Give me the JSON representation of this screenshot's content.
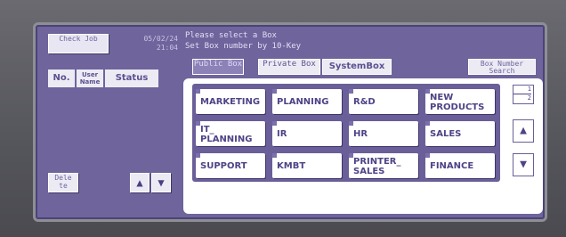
{
  "header": {
    "check_job": "Check Job",
    "date": "05/02/24",
    "time": "21:04"
  },
  "list_headers": {
    "no": "No.",
    "user_name": "User Name",
    "status": "Status"
  },
  "left_buttons": {
    "delete": "Dele te",
    "up_icon": "up-arrow-icon",
    "down_icon": "down-arrow-icon"
  },
  "message": {
    "line1": "Please select a Box",
    "line2": "Set Box number by 10-Key"
  },
  "tabs": {
    "public": "Public Box",
    "private": "Private Box",
    "system": "SystemBox"
  },
  "search": {
    "label": "Box Number Search"
  },
  "boxes": [
    "MARKETING",
    "PLANNING",
    "R&D",
    "NEW PRODUCTS",
    "IT_ PLANNING",
    "IR",
    "HR",
    "SALES",
    "SUPPORT",
    "KMBT",
    "PRINTER_ SALES",
    "FINANCE"
  ],
  "pagination": {
    "current": "1",
    "total": "2"
  },
  "colors": {
    "screen": "#6f649c",
    "button_face": "#ecebf4",
    "text_dark": "#4e4386"
  }
}
